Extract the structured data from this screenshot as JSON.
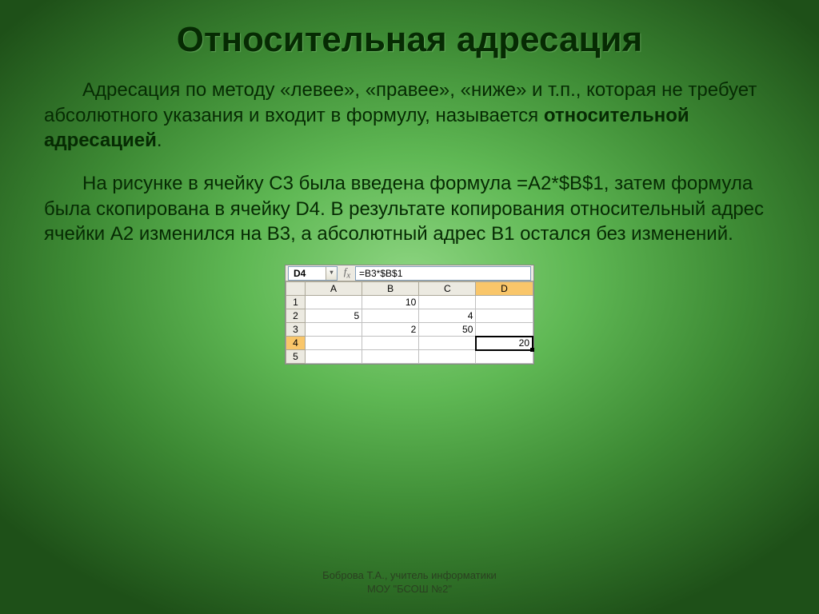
{
  "title": "Относительная адресация",
  "p1a": "Адресация по методу «левее», «правее», «ниже» и т.п., которая не требует абсолютного указания и входит в формулу, называется ",
  "p1b": "относительной адресацией",
  "p1c": ".",
  "p2": "На рисунке в ячейку С3 была введена формула =A2*$B$1, затем формула была скопирована в ячейку D4. В результате копирования относительный адрес ячейки A2 изменился на B3, а абсолютный адрес B1 остался без изменений.",
  "sheet": {
    "nameBox": "D4",
    "formula": "=B3*$B$1",
    "cols": [
      "A",
      "B",
      "C",
      "D"
    ],
    "rows": [
      "1",
      "2",
      "3",
      "4",
      "5"
    ],
    "cells": {
      "B1": "10",
      "A2": "5",
      "C2": "4",
      "B3": "2",
      "C3": "50",
      "D4": "20"
    },
    "selCol": "D",
    "selRow": "4",
    "selCell": "D4"
  },
  "footer1": "Боброва Т.А., учитель информатики",
  "footer2": "МОУ \"БСОШ №2\""
}
